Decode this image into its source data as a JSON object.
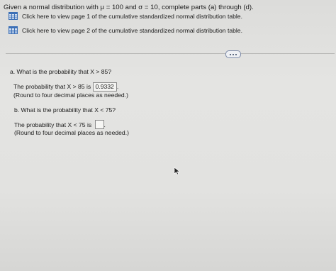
{
  "intro": {
    "prefix": "Given a normal distribution with μ = 100 and σ = 10, complete parts (a) through (d)."
  },
  "links": [
    {
      "icon": "table-icon",
      "label": "Click here to view page 1 of the cumulative standardized normal distribution table."
    },
    {
      "icon": "table-icon",
      "label": "Click here to view page 2 of the cumulative standardized normal distribution table."
    }
  ],
  "more_button": {
    "icon": "ellipsis-icon"
  },
  "part_a": {
    "question": "a. What is the probability that X > 85?",
    "answer_prefix": "The probability that X > 85 is",
    "answer_value": "0.9332",
    "answer_suffix": ".",
    "round_note": "(Round to four decimal places as needed.)"
  },
  "part_b": {
    "question": "b. What is the probability that X < 75?",
    "answer_prefix": "The probability that X < 75 is",
    "answer_value": "",
    "answer_suffix": ".",
    "round_note": "(Round to four decimal places as needed.)"
  },
  "colors": {
    "icon_blue": "#3b6fb6",
    "background": "#e2e2e0"
  }
}
